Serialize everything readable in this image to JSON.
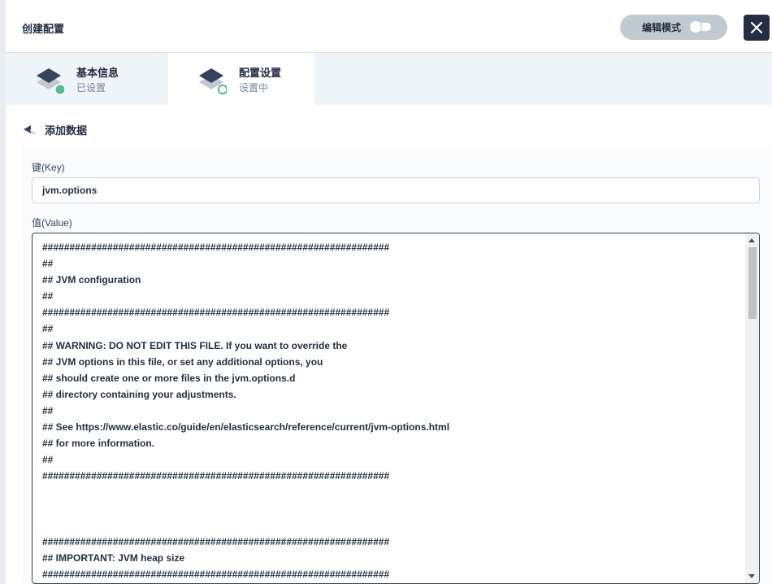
{
  "header": {
    "title": "创建配置",
    "edit_mode_label": "编辑模式",
    "close_icon": "close-icon"
  },
  "tabs": [
    {
      "title": "基本信息",
      "status": "已设置",
      "status_color": "#55bc8a"
    },
    {
      "title": "配置设置",
      "status": "设置中",
      "status_color": "#55bc8a"
    }
  ],
  "section": {
    "title": "添加数据",
    "back_icon": "back-arrow-icon"
  },
  "form": {
    "key_label": "键(Key)",
    "key_value": "jvm.options",
    "value_label": "值(Value)",
    "value_lines": "################################################################\n##\n## JVM configuration\n##\n################################################################\n##\n## WARNING: DO NOT EDIT THIS FILE. If you want to override the\n## JVM options in this file, or set any additional options, you\n## should create one or more files in the jvm.options.d\n## directory containing your adjustments.\n##\n## See https://www.elastic.co/guide/en/elasticsearch/reference/current/jvm-options.html\n## for more information.\n##\n################################################################\n\n\n\n################################################################\n## IMPORTANT: JVM heap size\n################################################################"
  },
  "colors": {
    "primary_dark": "#242e42",
    "success": "#55bc8a",
    "toggle_bg": "#c1c9d1"
  }
}
